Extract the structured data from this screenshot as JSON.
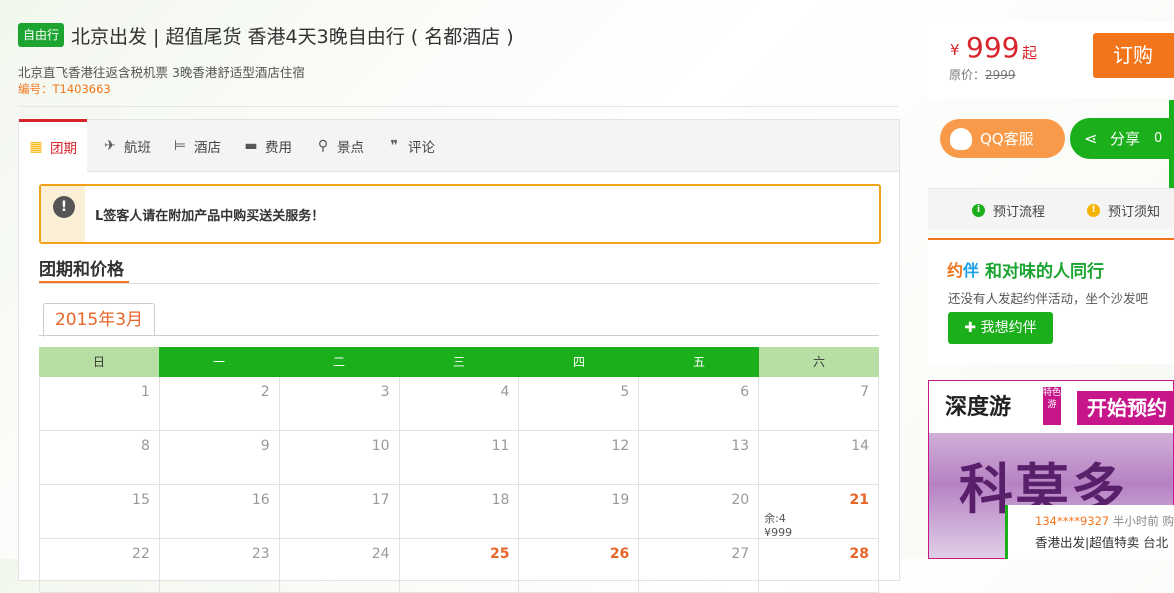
{
  "header": {
    "badge": "自由行",
    "title": "北京出发 | 超值尾货 香港4天3晚自由行 ( 名都酒店 )",
    "subtitle": "北京直飞香港往返含税机票 3晚香港舒适型酒店住宿",
    "code": "编号：T1403663"
  },
  "tabs": [
    {
      "label": "团期",
      "icon": "calendar-icon"
    },
    {
      "label": "航班",
      "icon": "plane-icon"
    },
    {
      "label": "酒店",
      "icon": "bed-icon"
    },
    {
      "label": "费用",
      "icon": "wallet-icon"
    },
    {
      "label": "景点",
      "icon": "map-pin-icon"
    },
    {
      "label": "评论",
      "icon": "quote-icon"
    }
  ],
  "notice": {
    "text": "L签客人请在附加产品中购买送关服务！",
    "icon": "alert-icon"
  },
  "section": {
    "title": "团期和价格"
  },
  "calendar": {
    "month": "2015年3月",
    "weekdays": [
      "日",
      "一",
      "二",
      "三",
      "四",
      "五",
      "六"
    ],
    "rows": [
      [
        {
          "day": "1"
        },
        {
          "day": "2"
        },
        {
          "day": "3"
        },
        {
          "day": "4"
        },
        {
          "day": "5"
        },
        {
          "day": "6"
        },
        {
          "day": "7"
        }
      ],
      [
        {
          "day": "8"
        },
        {
          "day": "9"
        },
        {
          "day": "10"
        },
        {
          "day": "11"
        },
        {
          "day": "12"
        },
        {
          "day": "13"
        },
        {
          "day": "14"
        }
      ],
      [
        {
          "day": "15"
        },
        {
          "day": "16"
        },
        {
          "day": "17"
        },
        {
          "day": "18"
        },
        {
          "day": "19"
        },
        {
          "day": "20"
        },
        {
          "day": "21",
          "hl": true,
          "remain": "余:4",
          "price": "¥999"
        }
      ],
      [
        {
          "day": "22"
        },
        {
          "day": "23"
        },
        {
          "day": "24"
        },
        {
          "day": "25",
          "hl": true
        },
        {
          "day": "26",
          "hl": true
        },
        {
          "day": "27"
        },
        {
          "day": "28",
          "hl": true
        }
      ]
    ]
  },
  "price": {
    "currency": "¥",
    "amount": "999",
    "suffix": "起",
    "original_label": "原价：",
    "original": "2999"
  },
  "buttons": {
    "book": "订购",
    "qq": "QQ客服",
    "share": "分享",
    "share_count": "0"
  },
  "process": {
    "flow": "预订流程",
    "notice": "预订须知"
  },
  "companion": {
    "logo1": "约",
    "logo2": "伴",
    "title": "和对味的人同行",
    "subtitle": "还没有人发起约伴活动，坐个沙发吧",
    "button": "✚ 我想约伴"
  },
  "ad": {
    "brand": "深度游",
    "seal": "特色游",
    "badge": "开始预约",
    "big": "科莫多"
  },
  "ticker": {
    "user": "134****9327",
    "meta": " 半小时前 购买",
    "product": "香港出发|超值特卖 台北"
  },
  "colors": {
    "brand_green": "#1caf1c",
    "accent_orange": "#f2741b",
    "price_red": "#d8242c",
    "ad_magenta": "#c7168a"
  }
}
